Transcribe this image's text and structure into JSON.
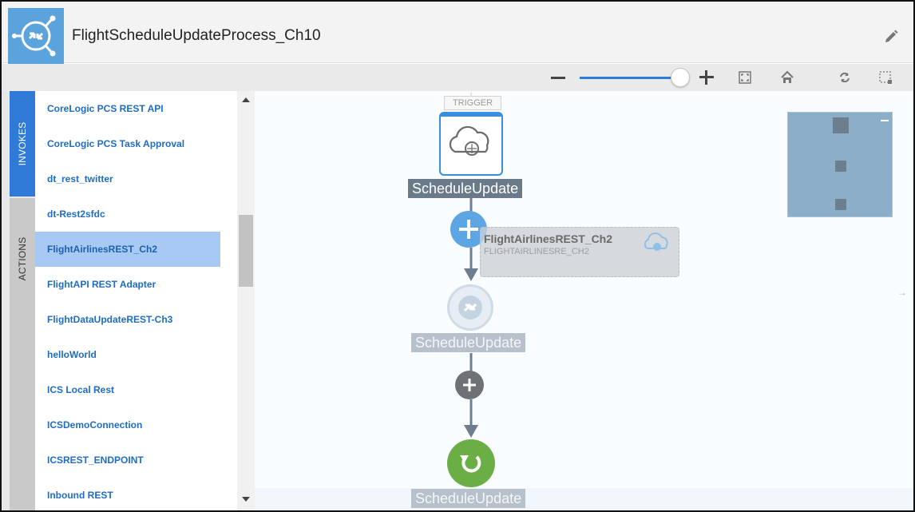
{
  "header": {
    "title": "FlightScheduleUpdateProcess_Ch10",
    "logo_icon": "integration-logo-icon",
    "edit_icon": "pencil-icon"
  },
  "toolbar": {
    "zoom_out_icon": "minus-icon",
    "zoom_in_icon": "plus-icon",
    "zoom_level_fraction": 0.9,
    "fit_icon": "fit-to-screen-icon",
    "home_icon": "home-icon",
    "refresh_icon": "refresh-icon",
    "select_icon": "marquee-select-icon"
  },
  "tabs": {
    "invokes": "INVOKES",
    "actions": "ACTIONS",
    "active": "INVOKES"
  },
  "invokes_list": {
    "items": [
      "CoreLogic PCS REST API",
      "CoreLogic PCS Task Approval",
      "dt_rest_twitter",
      "dt-Rest2sfdc",
      "FlightAirlinesREST_Ch2",
      "FlightAPI REST Adapter",
      "FlightDataUpdateREST-Ch3",
      "helloWorld",
      "ICS Local Rest",
      "ICSDemoConnection",
      "ICSREST_ENDPOINT",
      "Inbound REST"
    ],
    "selected_index": 4
  },
  "canvas": {
    "trigger_label": "TRIGGER",
    "trigger_node_label": "ScheduleUpdate",
    "map_node_label": "ScheduleUpdate",
    "end_node_label": "ScheduleUpdate",
    "drag_card": {
      "name": "FlightAirlinesREST_Ch2",
      "identifier": "FLIGHTAIRLINESRE_CH2"
    },
    "colors": {
      "accent": "#2e7ad6",
      "add_blue": "#5ea5e3",
      "add_gray": "#6e7276",
      "end_green": "#6cae46",
      "label_bg": "#6b7a89",
      "minimap": "#8caec8"
    }
  }
}
